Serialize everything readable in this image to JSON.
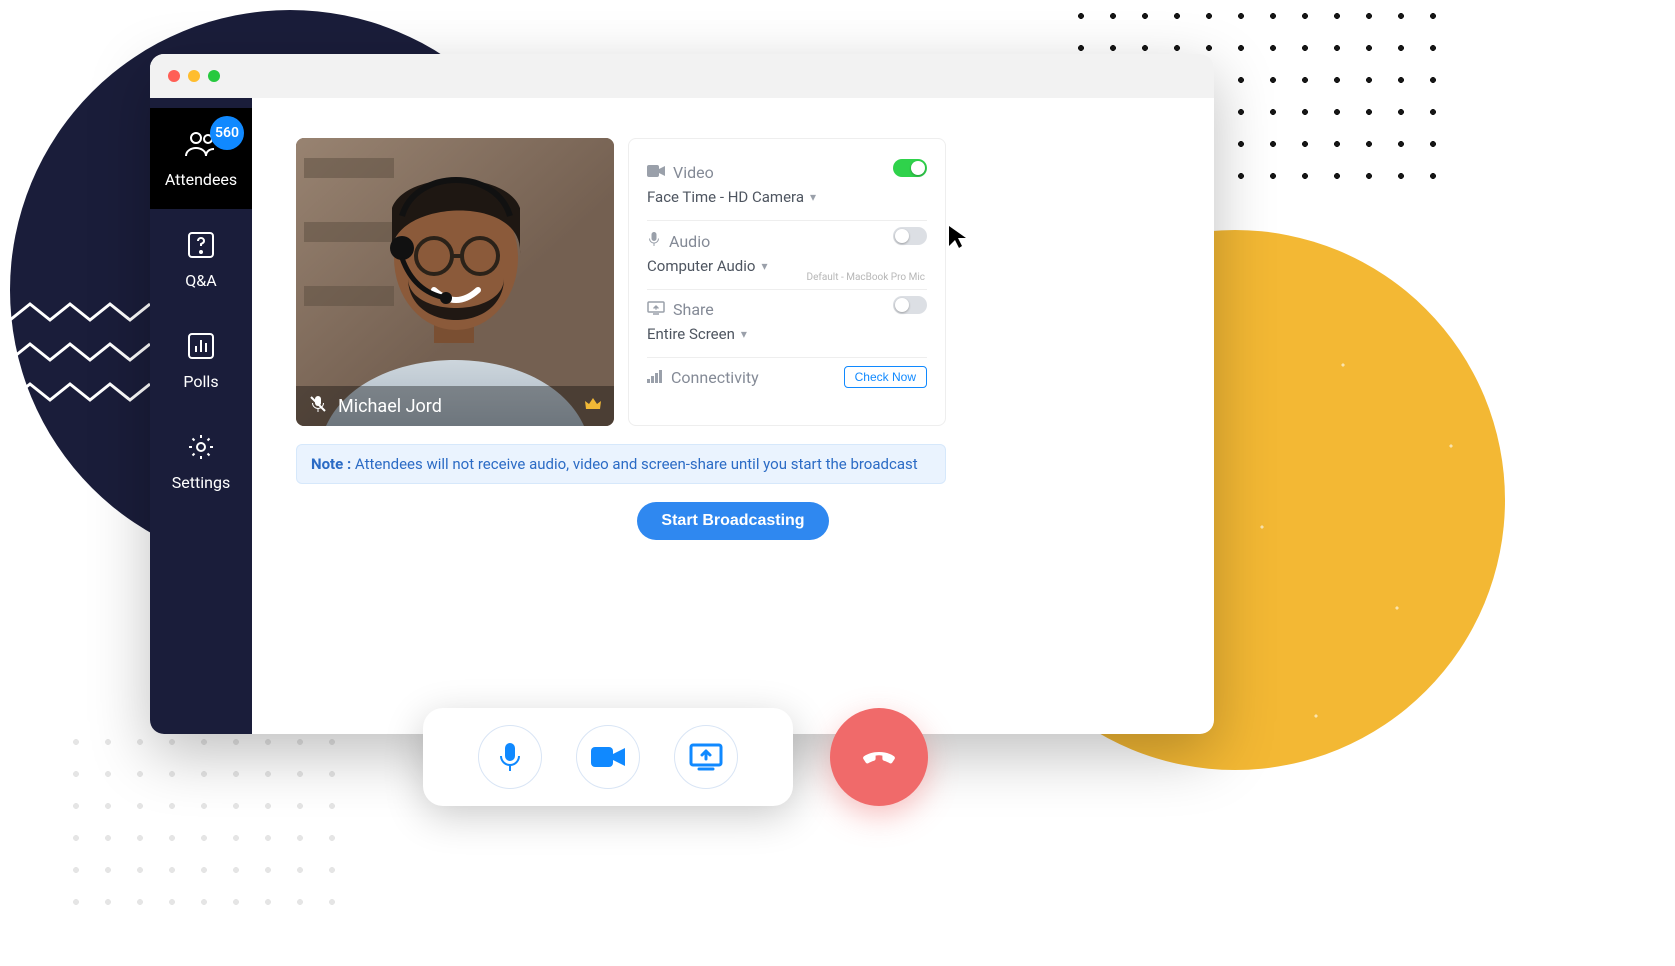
{
  "sidebar": {
    "attendees": {
      "label": "Attendees",
      "badge": "560"
    },
    "qa": {
      "label": "Q&A"
    },
    "polls": {
      "label": "Polls"
    },
    "settings": {
      "label": "Settings"
    }
  },
  "presenter": {
    "name": "Michael Jord"
  },
  "settingsCard": {
    "video": {
      "label": "Video",
      "device": "Face Time - HD Camera",
      "on": true
    },
    "audio": {
      "label": "Audio",
      "device": "Computer Audio",
      "defaultText": "Default - MacBook Pro Mic",
      "on": false
    },
    "share": {
      "label": "Share",
      "target": "Entire Screen",
      "on": false
    },
    "connectivity": {
      "label": "Connectivity",
      "action": "Check Now"
    }
  },
  "note": {
    "prefix": "Note :",
    "text": "Attendees will not receive audio, video and screen-share until you start the broadcast"
  },
  "actions": {
    "start": "Start Broadcasting"
  }
}
